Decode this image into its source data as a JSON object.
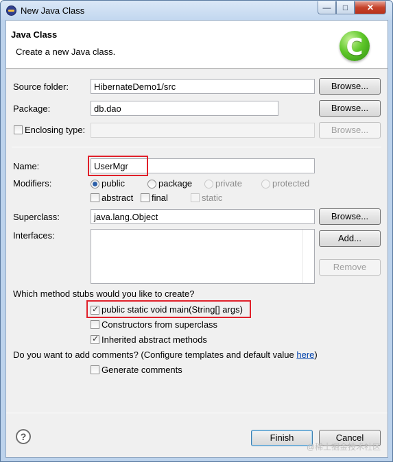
{
  "window": {
    "title": "New Java Class",
    "controls": {
      "minimize": "—",
      "maximize": "□",
      "close": "✕"
    }
  },
  "banner": {
    "title": "Java Class",
    "subtitle": "Create a new Java class.",
    "icon": "java-class-c-icon",
    "icon_letter": "C"
  },
  "form": {
    "source_folder": {
      "label": "Source folder:",
      "value": "HibernateDemo1/src",
      "browse": "Browse..."
    },
    "package": {
      "label": "Package:",
      "value": "db.dao",
      "browse": "Browse..."
    },
    "enclosing_type": {
      "label": "Enclosing type:",
      "checked": false,
      "value": "",
      "browse": "Browse..."
    },
    "name": {
      "label": "Name:",
      "value": "UserMgr"
    },
    "modifiers": {
      "label": "Modifiers:",
      "visibility": [
        {
          "label": "public",
          "selected": true,
          "enabled": true
        },
        {
          "label": "package",
          "selected": false,
          "enabled": true
        },
        {
          "label": "private",
          "selected": false,
          "enabled": false
        },
        {
          "label": "protected",
          "selected": false,
          "enabled": false
        }
      ],
      "flags": [
        {
          "label": "abstract",
          "checked": false,
          "enabled": true
        },
        {
          "label": "final",
          "checked": false,
          "enabled": true
        },
        {
          "label": "static",
          "checked": false,
          "enabled": false
        }
      ]
    },
    "superclass": {
      "label": "Superclass:",
      "value": "java.lang.Object",
      "browse": "Browse..."
    },
    "interfaces": {
      "label": "Interfaces:",
      "add": "Add...",
      "remove": "Remove"
    },
    "stubs": {
      "question": "Which method stubs would you like to create?",
      "options": [
        {
          "label": "public static void main(String[] args)",
          "checked": true
        },
        {
          "label": "Constructors from superclass",
          "checked": false
        },
        {
          "label": "Inherited abstract methods",
          "checked": true
        }
      ]
    },
    "comments": {
      "question_prefix": "Do you want to add comments? (Configure templates and default value ",
      "link": "here",
      "question_suffix": ")",
      "generate": {
        "label": "Generate comments",
        "checked": false
      }
    }
  },
  "footer": {
    "help": "?",
    "finish": "Finish",
    "cancel": "Cancel"
  },
  "watermark": "@稀土掘金技术社区",
  "colors": {
    "highlight": "#e0202a",
    "link": "#0645ad",
    "titlebar": "#c2d7ef"
  }
}
